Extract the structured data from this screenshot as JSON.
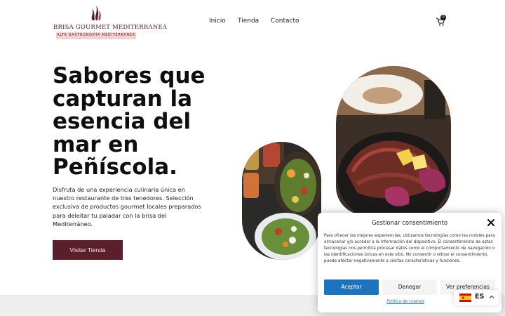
{
  "brand": {
    "name": "BRISA GOURMET MEDITERRANEA",
    "tagline": "ALTA GASTRONOMÍA MEDITERRÁNEA",
    "accent": "#5b1e2b"
  },
  "nav": {
    "items": [
      "Inicio",
      "Tienda",
      "Contacto"
    ],
    "cart_count": "0",
    "cart_icon": "cart-icon"
  },
  "hero": {
    "title": "Sabores que capturan la esencia del mar en Peñíscola.",
    "text": "Disfruta de una experiencia culinaria única en nuestro restaurante de tres tenedores. Selección exclusiva de productos gourmet locales preparados para deleitar tu paladar con la brisa del Mediterráneo.",
    "button": "Visitar Tienda"
  },
  "cookie": {
    "title": "Gestionar consentimiento",
    "text": "Para ofrecer las mejores experiencias, utilizamos tecnologías como las cookies para almacenar y/o acceder a la información del dispositivo. El consentimiento de estas tecnologías nos permitirá procesar datos como el comportamiento de navegación o las identificaciones únicas en este sitio. No consentir o retirar el consentimiento, puede afectar negativamente a ciertas características y funciones.",
    "accept": "Aceptar",
    "deny": "Denegar",
    "prefs": "Ver preferencias",
    "policy_link": "Política de cookies",
    "accept_color": "#1e73be"
  },
  "language": {
    "code": "ES",
    "flag_icon": "spain-flag-icon"
  }
}
